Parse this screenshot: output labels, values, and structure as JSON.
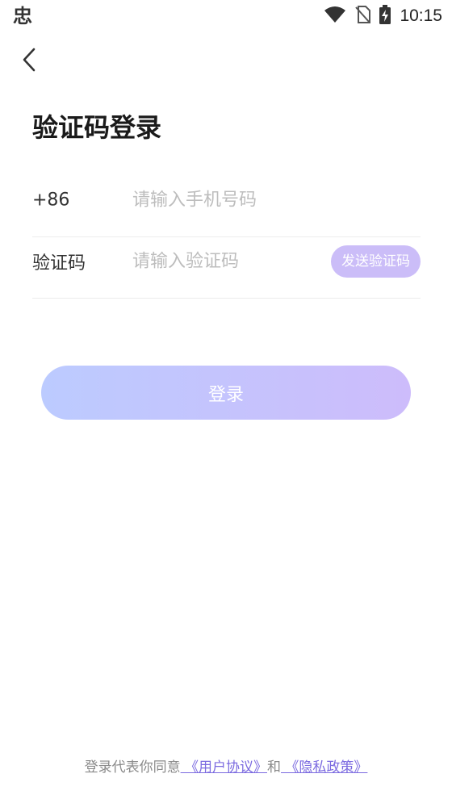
{
  "status_bar": {
    "app_glyph": "忠",
    "time": "10:15",
    "icons": [
      "wifi-icon",
      "no-sim-icon",
      "battery-charging-icon"
    ]
  },
  "header": {
    "back_icon": "chevron-left-icon",
    "title": "验证码登录"
  },
  "form": {
    "phone": {
      "prefix": "+86",
      "placeholder": "请输入手机号码",
      "value": ""
    },
    "code": {
      "label": "验证码",
      "placeholder": "请输入验证码",
      "value": "",
      "send_button": "发送验证码"
    }
  },
  "login_button": "登录",
  "agreement": {
    "prefix": "登录代表你同意",
    "user_agreement": " 《用户协议》",
    "conjunction": "和",
    "privacy_policy": " 《隐私政策》"
  },
  "colors": {
    "accent": "#cbbdf8",
    "gradient_start": "#bccbff",
    "gradient_end": "#cdbcfb",
    "link": "#7b6ae0"
  }
}
